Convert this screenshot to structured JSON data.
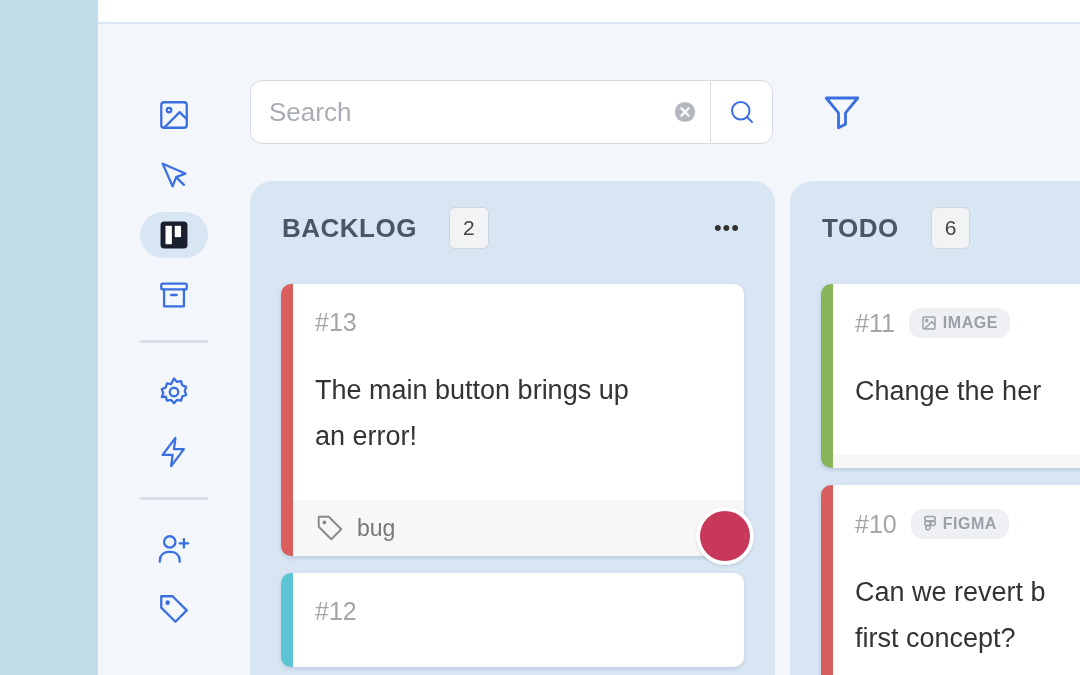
{
  "sidebar": {
    "groups": [
      {
        "items": [
          {
            "kind": "image",
            "selected": false
          },
          {
            "kind": "pointer",
            "selected": false
          },
          {
            "kind": "board",
            "selected": true
          },
          {
            "kind": "archive",
            "selected": false
          }
        ]
      },
      {
        "items": [
          {
            "kind": "settings",
            "selected": false
          },
          {
            "kind": "bolt",
            "selected": false
          }
        ]
      },
      {
        "items": [
          {
            "kind": "add-user",
            "selected": false
          },
          {
            "kind": "tag",
            "selected": false
          }
        ]
      }
    ]
  },
  "search": {
    "placeholder": "Search"
  },
  "columns": [
    {
      "title": "BACKLOG",
      "count": "2",
      "menu_label": "•••",
      "cards": [
        {
          "number": "#13",
          "color": "#d95f5f",
          "lines": [
            "The main button brings up",
            "an error!"
          ],
          "footer": true,
          "footer_tag": "bug",
          "avatar": true
        },
        {
          "number": "#12",
          "color": "#5bc4d4",
          "footer": false,
          "avatar": false
        }
      ]
    },
    {
      "title": "TODO",
      "count": "6",
      "cards": [
        {
          "number": "#11",
          "color": "#86b55a",
          "tag": {
            "kind": "image",
            "label": "IMAGE"
          },
          "lines": [
            "Change the her"
          ],
          "footer": true,
          "avatar": false
        },
        {
          "number": "#10",
          "color": "#d95f5f",
          "tag": {
            "kind": "figma",
            "label": "FIGMA"
          },
          "lines": [
            "Can we revert b",
            "first concept?"
          ],
          "footer": false,
          "avatar": false
        }
      ]
    }
  ]
}
